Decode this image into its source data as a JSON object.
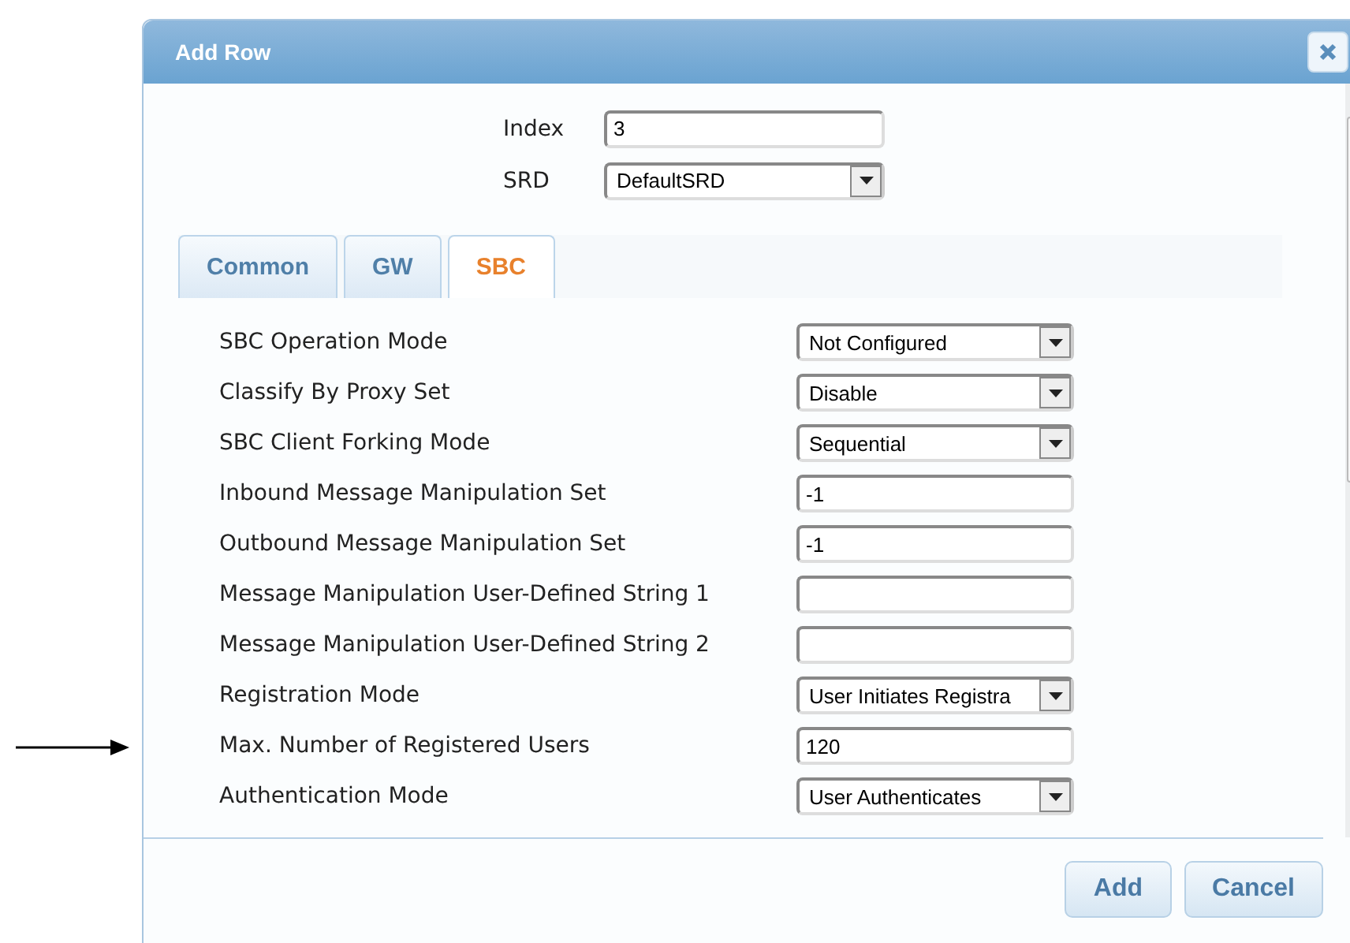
{
  "dialog": {
    "title": "Add Row"
  },
  "header_fields": [
    {
      "label": "Index",
      "kind": "text",
      "value": "3"
    },
    {
      "label": "SRD",
      "kind": "select",
      "value": "DefaultSRD"
    }
  ],
  "tabs": [
    {
      "label": "Common",
      "selected": false
    },
    {
      "label": "GW",
      "selected": false
    },
    {
      "label": "SBC",
      "selected": true
    }
  ],
  "fields": [
    {
      "label": "SBC Operation Mode",
      "kind": "select",
      "value": "Not Configured"
    },
    {
      "label": "Classify By Proxy Set",
      "kind": "select",
      "value": "Disable"
    },
    {
      "label": "SBC Client Forking Mode",
      "kind": "select",
      "value": "Sequential"
    },
    {
      "label": "Inbound Message Manipulation Set",
      "kind": "text",
      "value": "-1"
    },
    {
      "label": "Outbound Message Manipulation Set",
      "kind": "text",
      "value": "-1"
    },
    {
      "label": "Message Manipulation User-Defined String 1",
      "kind": "text"
    },
    {
      "label": "Message Manipulation User-Defined String 2",
      "kind": "text"
    },
    {
      "label": "Registration Mode",
      "kind": "select",
      "value": "User Initiates Registra"
    },
    {
      "label": "Max. Number of Registered Users",
      "kind": "text",
      "value": "120"
    },
    {
      "label": "Authentication Mode",
      "kind": "select",
      "value": "User Authenticates"
    }
  ],
  "buttons": [
    "Add",
    "Cancel"
  ]
}
